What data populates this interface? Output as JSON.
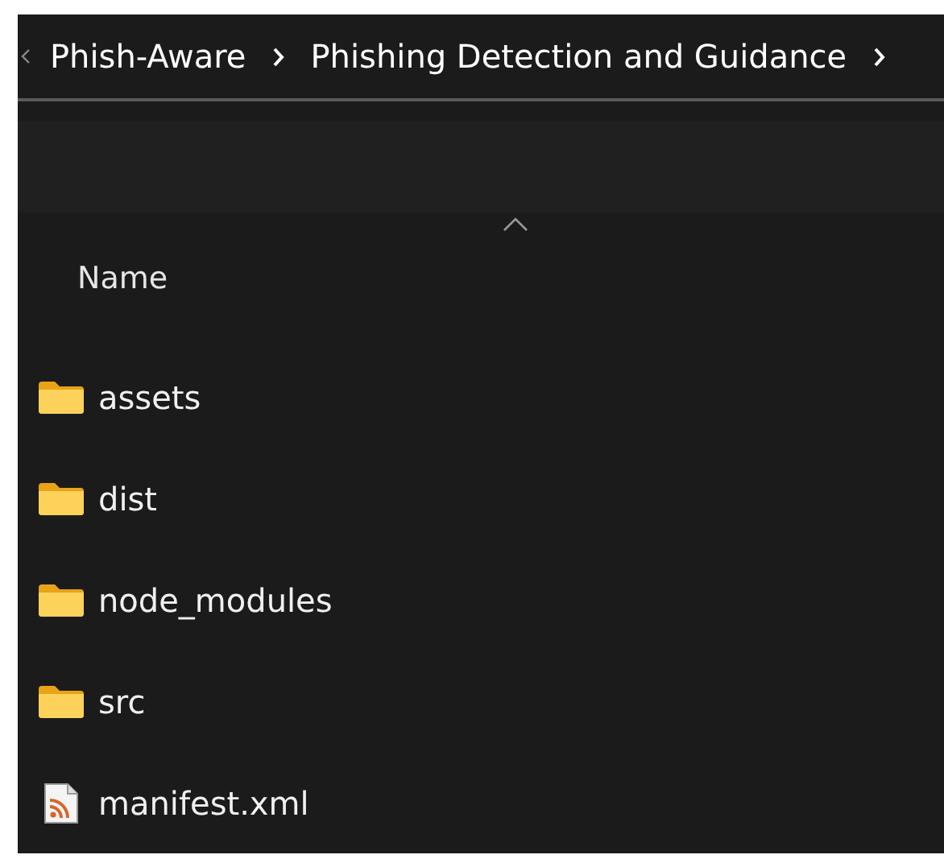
{
  "breadcrumb": [
    "Phish-Aware",
    "Phishing Detection and Guidance"
  ],
  "columns": [
    {
      "label": "Name",
      "sorted_ascending": true
    }
  ],
  "items": [
    {
      "name": "assets",
      "kind": "folder"
    },
    {
      "name": "dist",
      "kind": "folder"
    },
    {
      "name": "node_modules",
      "kind": "folder"
    },
    {
      "name": "src",
      "kind": "folder"
    },
    {
      "name": "manifest.xml",
      "kind": "feed"
    }
  ]
}
